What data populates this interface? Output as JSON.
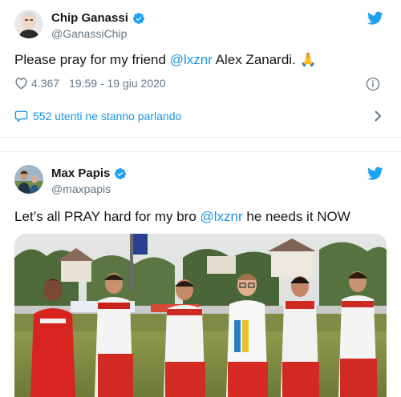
{
  "tweet1": {
    "name": "Chip Ganassi",
    "handle": "@GanassiChip",
    "text_before": "Please pray for my friend ",
    "mention": "@lxznr",
    "text_after": "  Alex Zanardi. ",
    "emoji": "🙏",
    "likes": "4.367",
    "timestamp": "19:59 - 19 giu 2020",
    "talking": "552 utenti ne stanno parlando"
  },
  "tweet2": {
    "name": "Max Papis",
    "handle": "@maxpapis",
    "text_before": "Let’s all PRAY hard for my bro ",
    "mention": "@lxznr",
    "text_after": " he needs it NOW"
  },
  "colors": {
    "accent": "#1da1f2",
    "link": "#1b95e0",
    "muted": "#657786"
  },
  "icons": [
    "verified-badge-icon",
    "twitter-bird-icon",
    "heart-icon",
    "info-icon",
    "speech-bubble-icon",
    "chevron-right-icon"
  ]
}
